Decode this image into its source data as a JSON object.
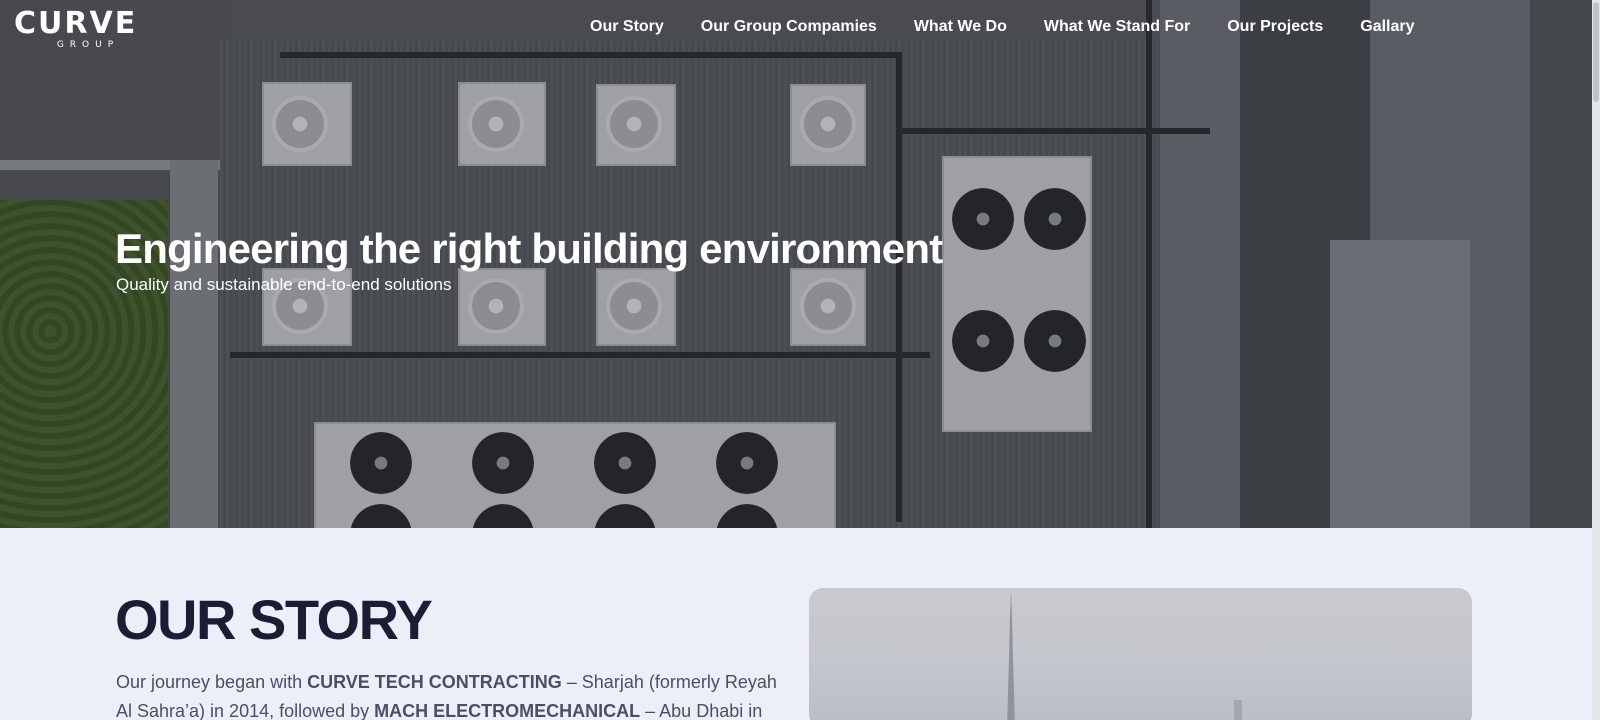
{
  "brand": {
    "logo_word": "CURVE",
    "logo_sub": "GROUP"
  },
  "nav": {
    "items": [
      {
        "label": "Our Story"
      },
      {
        "label": "Our Group Compamies"
      },
      {
        "label": "What We Do"
      },
      {
        "label": "What We Stand For"
      },
      {
        "label": "Our Projects"
      },
      {
        "label": "Gallary"
      }
    ]
  },
  "hero": {
    "title": "Engineering the right building environment",
    "subtitle": "Quality and sustainable end-to-end solutions"
  },
  "story": {
    "title": "OUR STORY",
    "paragraph": [
      {
        "text": "Our journey began with ",
        "bold": false
      },
      {
        "text": "CURVE TECH CONTRACTING",
        "bold": true
      },
      {
        "text": " – Sharjah (formerly Reyah Al Sahra’a) in 2014, followed by ",
        "bold": false
      },
      {
        "text": "MACH ELECTROMECHANICAL",
        "bold": true
      },
      {
        "text": " – Abu Dhabi in",
        "bold": false
      }
    ]
  },
  "colors": {
    "heading": "#1a1e35",
    "body_text": "#4a4f66",
    "section_bg": "#eceef8",
    "nav_text": "#ffffff"
  }
}
